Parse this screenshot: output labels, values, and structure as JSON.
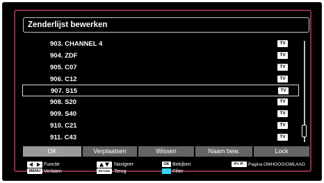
{
  "header": {
    "title": "Zenderlijst bewerken"
  },
  "channels": [
    {
      "name": "903. CHANNEL 4",
      "type": "TV"
    },
    {
      "name": "904. ZDF",
      "type": "TV"
    },
    {
      "name": "905. C07",
      "type": "TV"
    },
    {
      "name": "906. C12",
      "type": "TV"
    },
    {
      "name": "907. S15",
      "type": "TV",
      "selected": true
    },
    {
      "name": "908. S20",
      "type": "TV"
    },
    {
      "name": "909. S40",
      "type": "TV"
    },
    {
      "name": "910. C21",
      "type": "TV"
    },
    {
      "name": "911. C43",
      "type": "TV"
    }
  ],
  "buttons": {
    "ok": "OK",
    "move": "Verplaatsen",
    "delete": "Wissen",
    "rename": "Naam bew.",
    "lock": "Lock"
  },
  "legend": {
    "function": "Functie",
    "exit": "Verlaten",
    "navigate": "Navigeer",
    "back": "Terug",
    "view": "Bekijken",
    "filter": "Filter",
    "page": "Pagina OMHOOG/OMLAAG",
    "keys": {
      "menu": "MENU",
      "return": "RETURN",
      "ok": "OK",
      "page": "P+ P-"
    }
  },
  "colors": {
    "frame": "#8a2a57",
    "filter_key": "#34d4f0",
    "button_active": "#9a9a9a",
    "button": "#646464"
  }
}
